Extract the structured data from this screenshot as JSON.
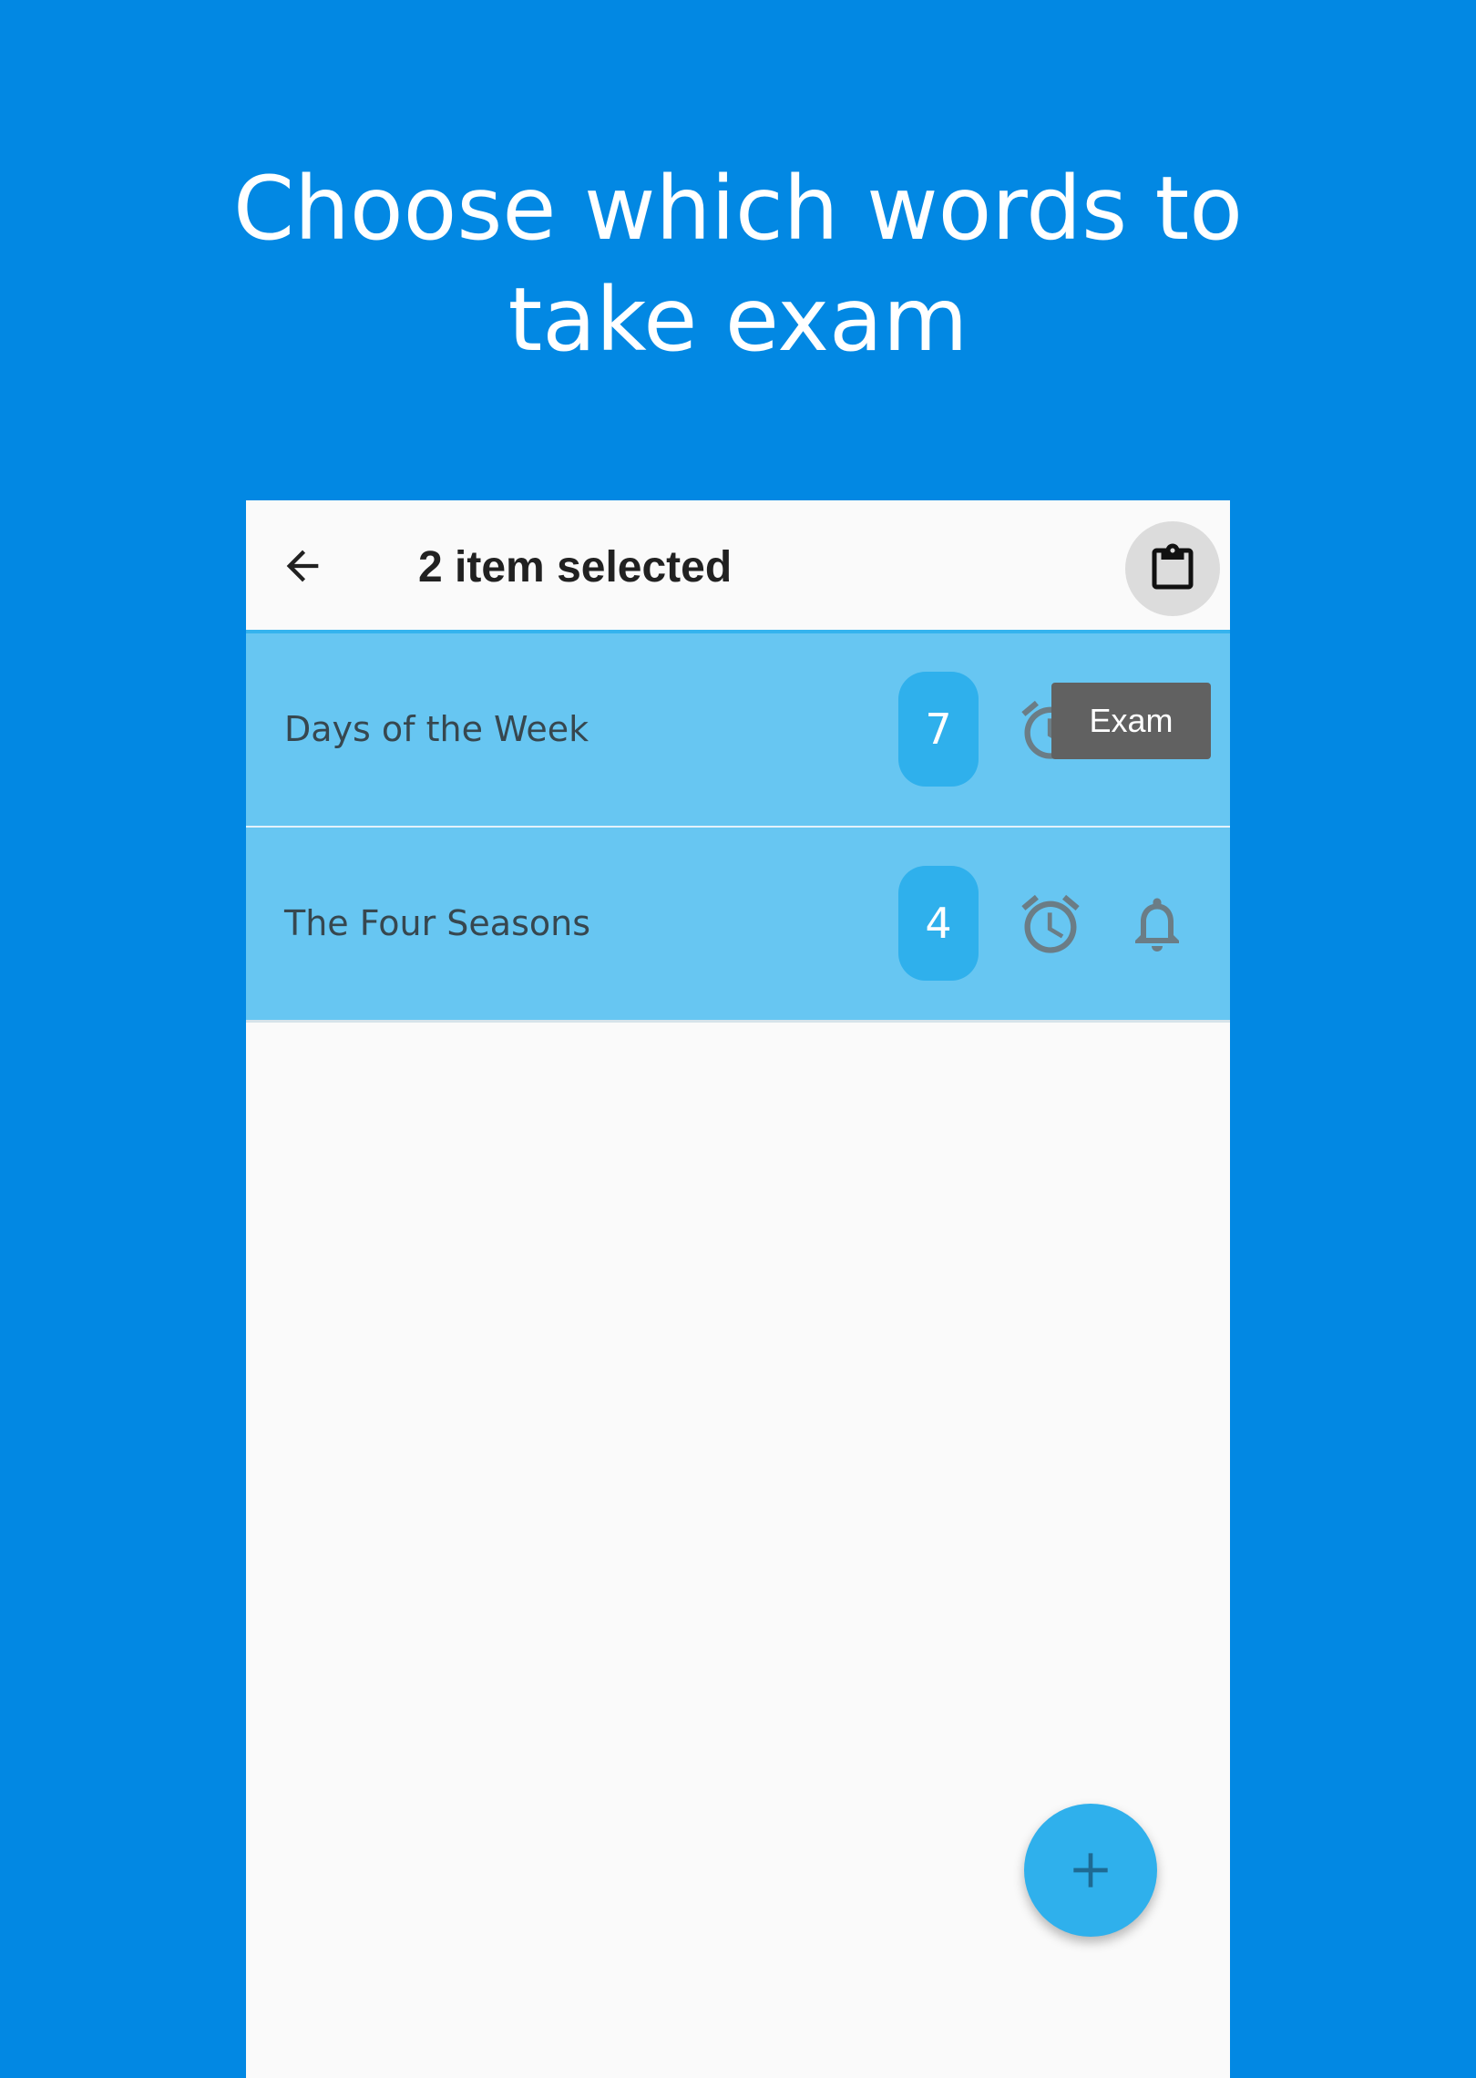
{
  "headline": {
    "line1": "Choose which words to",
    "line2": "take exam"
  },
  "colors": {
    "background": "#0288E3",
    "selected_row": "#67C6F2",
    "accent": "#2FB0EC",
    "tooltip": "#616161"
  },
  "appbar": {
    "back_icon": "arrow-back-icon",
    "title": "2 item selected",
    "action_icon": "clipboard-icon"
  },
  "tooltip": {
    "label": "Exam"
  },
  "list": {
    "items": [
      {
        "label": "Days of the Week",
        "count": "7",
        "selected": true
      },
      {
        "label": "The Four Seasons",
        "count": "4",
        "selected": true
      }
    ]
  },
  "fab": {
    "icon": "plus-icon"
  }
}
